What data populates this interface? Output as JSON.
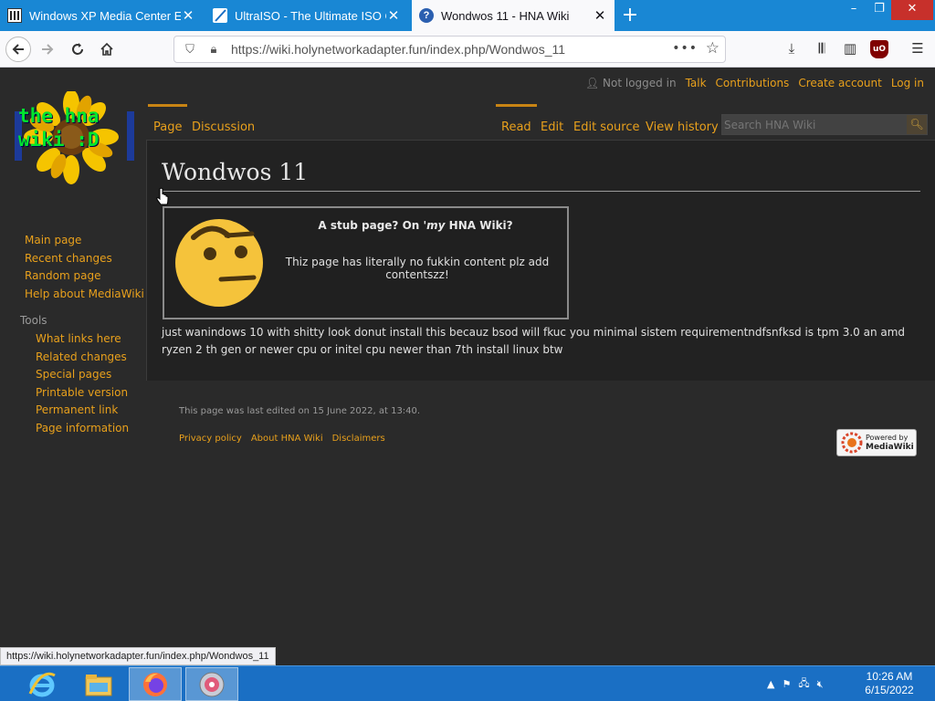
{
  "browser": {
    "tabs": [
      {
        "title": "Windows XP Media Center Edition",
        "icon": "archive-icon"
      },
      {
        "title": "UltraISO - The Ultimate ISO CD",
        "icon": "ultraiso-icon"
      },
      {
        "title": "Wondwos 11 - HNA Wiki",
        "icon": "wiki-icon"
      }
    ],
    "new_tab": "+",
    "window_controls": {
      "minimize": "–",
      "maximize": "❐",
      "close": "✕"
    },
    "url": "https://wiki.holynetworkadapter.fun/index.php/Wondwos_11",
    "status_url": "https://wiki.holynetworkadapter.fun/index.php/Wondwos_11"
  },
  "wiki": {
    "logo_text": [
      "the hna",
      "wiki :D"
    ],
    "personal": {
      "not_logged_in": "Not logged in",
      "talk": "Talk",
      "contributions": "Contributions",
      "create_account": "Create account",
      "log_in": "Log in"
    },
    "tabs_left": [
      "Page",
      "Discussion"
    ],
    "tabs_right": [
      "Read",
      "Edit",
      "Edit source",
      "View history"
    ],
    "search_placeholder": "Search HNA Wiki",
    "title": "Wondwos 11",
    "stub": {
      "title_prefix": "A stub page? On '",
      "title_em": "my",
      "title_suffix": " HNA Wiki?",
      "text": "Thiz page has literally no fukkin content plz add contentszz!"
    },
    "body": "just wanindows 10 with shitty look donut install this becauz bsod will fkuc you minimal sistem requirementndfsnfksd is tpm 3.0 an amd ryzen 2 th gen or newer cpu or initel cpu newer than 7th install linux btw",
    "nav": [
      "Main page",
      "Recent changes",
      "Random page",
      "Help about MediaWiki"
    ],
    "tools_label": "Tools",
    "tools": [
      "What links here",
      "Related changes",
      "Special pages",
      "Printable version",
      "Permanent link",
      "Page information"
    ],
    "footer": {
      "last_edited": "This page was last edited on 15 June 2022, at 13:40.",
      "links": [
        "Privacy policy",
        "About HNA Wiki",
        "Disclaimers"
      ],
      "powered_by": "Powered by",
      "mediawiki": "MediaWiki"
    }
  },
  "taskbar": {
    "apps": [
      "internet-explorer-icon",
      "file-explorer-icon",
      "firefox-icon",
      "ultraiso-disc-icon"
    ],
    "clock_time": "10:26 AM",
    "clock_date": "6/15/2022",
    "tray_chevron": "▲"
  },
  "colors": {
    "accent": "#e8a01c",
    "page_bg": "#2a2a2a",
    "content_bg": "#222222",
    "taskbar": "#1a6fc4",
    "tabbar": "#1987d4"
  }
}
